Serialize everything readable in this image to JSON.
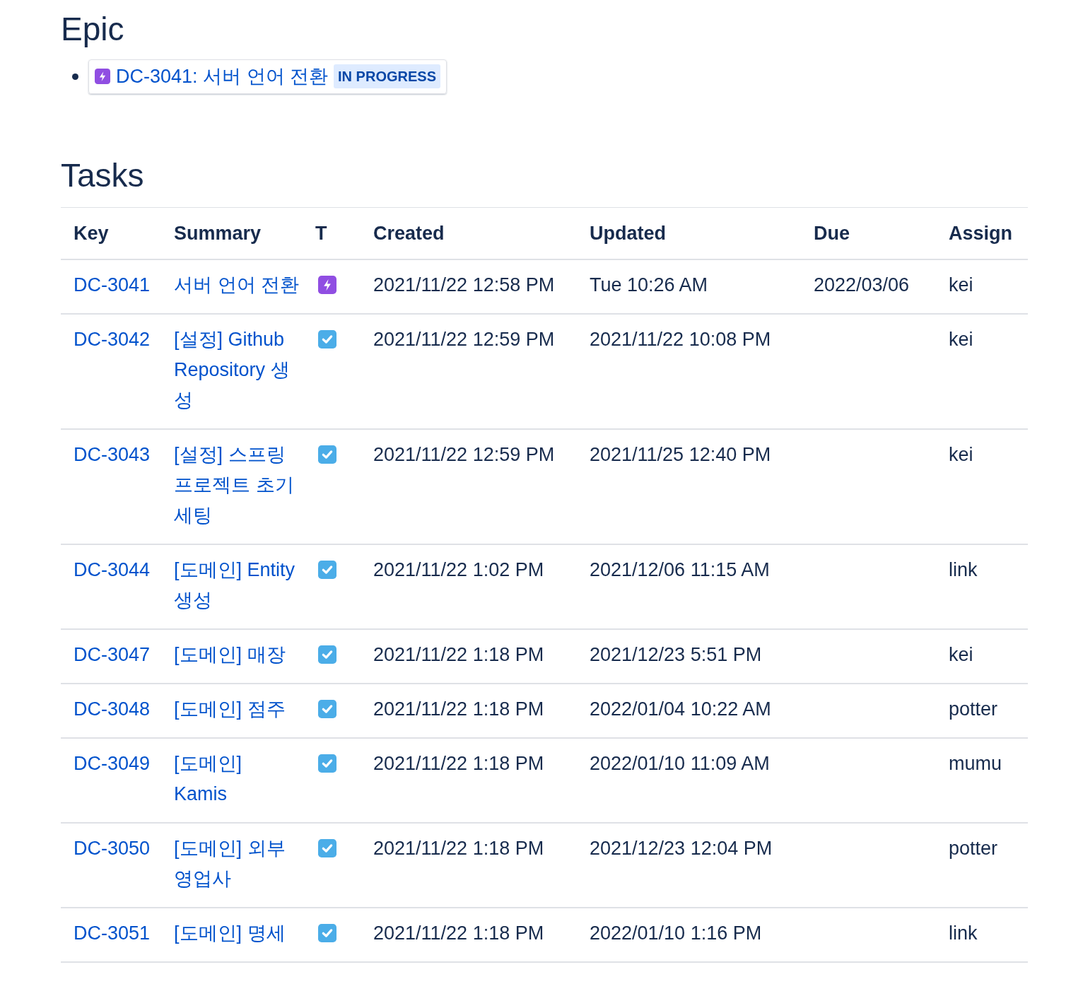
{
  "epic_section": {
    "heading": "Epic",
    "items": [
      {
        "kind": "epic",
        "label": "DC-3041: 서버 언어 전환",
        "status": "IN PROGRESS"
      }
    ]
  },
  "tasks_section": {
    "heading": "Tasks",
    "table": {
      "columns": [
        "Key",
        "Summary",
        "T",
        "Created",
        "Updated",
        "Due",
        "Assign"
      ],
      "rows": [
        {
          "key": "DC-3041",
          "summary": "서버 언어 전환",
          "kind": "epic",
          "created": "2021/11/22 12:58 PM",
          "updated": "Tue 10:26 AM",
          "due": "2022/03/06",
          "assignee": "kei"
        },
        {
          "key": "DC-3042",
          "summary": "[설정] Github Repository 생성",
          "kind": "task",
          "created": "2021/11/22 12:59 PM",
          "updated": "2021/11/22 10:08 PM",
          "assignee": "kei"
        },
        {
          "key": "DC-3043",
          "summary": "[설정] 스프링 프로젝트 초기 세팅",
          "kind": "task",
          "created": "2021/11/22 12:59 PM",
          "updated": "2021/11/25 12:40 PM",
          "assignee": "kei"
        },
        {
          "key": "DC-3044",
          "summary": "[도메인] Entity 생성",
          "kind": "task",
          "created": "2021/11/22 1:02 PM",
          "updated": "2021/12/06 11:15 AM",
          "assignee": "link"
        },
        {
          "key": "DC-3047",
          "summary": "[도메인] 매장",
          "kind": "task",
          "created": "2021/11/22 1:18 PM",
          "updated": "2021/12/23 5:51 PM",
          "assignee": "kei"
        },
        {
          "key": "DC-3048",
          "summary": "[도메인] 점주",
          "kind": "task",
          "created": "2021/11/22 1:18 PM",
          "updated": "2022/01/04 10:22 AM",
          "assignee": "potter"
        },
        {
          "key": "DC-3049",
          "summary": "[도메인] Kamis",
          "kind": "task",
          "created": "2021/11/22 1:18 PM",
          "updated": "2022/01/10 11:09 AM",
          "assignee": "mumu"
        },
        {
          "key": "DC-3050",
          "summary": "[도메인] 외부 영업사",
          "kind": "task",
          "created": "2021/11/22 1:18 PM",
          "updated": "2021/12/23 12:04 PM",
          "assignee": "potter"
        },
        {
          "key": "DC-3051",
          "summary": "[도메인] 명세",
          "kind": "task",
          "created": "2021/11/22 1:18 PM",
          "updated": "2022/01/10 1:16 PM",
          "assignee": "link"
        }
      ]
    }
  }
}
